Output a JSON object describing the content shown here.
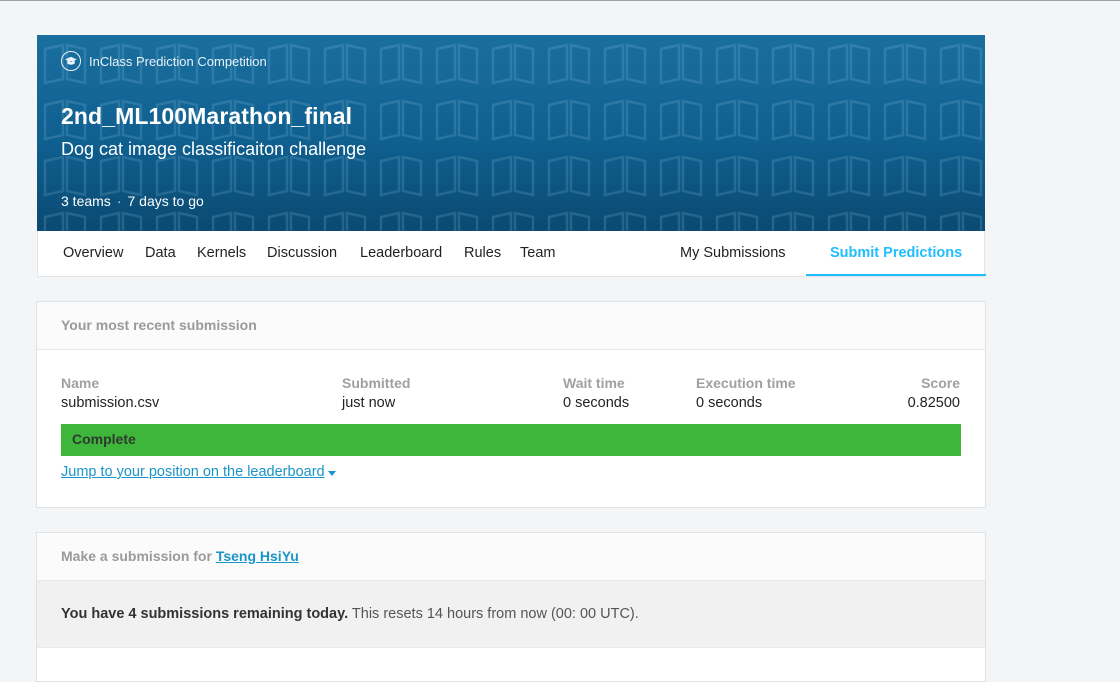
{
  "banner": {
    "badge_label": "InClass Prediction Competition",
    "title": "2nd_ML100Marathon_final",
    "subtitle": "Dog cat image classificaiton challenge",
    "teams": "3 teams",
    "separator": "·",
    "time_left": "7 days to go"
  },
  "nav": {
    "tabs": [
      "Overview",
      "Data",
      "Kernels",
      "Discussion",
      "Leaderboard",
      "Rules",
      "Team"
    ],
    "my_submissions": "My Submissions",
    "submit_predictions": "Submit Predictions",
    "accent": "#20beff"
  },
  "recent": {
    "header": "Your most recent submission",
    "columns": {
      "name": {
        "label": "Name",
        "value": "submission.csv"
      },
      "submitted": {
        "label": "Submitted",
        "value": "just now"
      },
      "wait": {
        "label": "Wait time",
        "value": "0 seconds"
      },
      "execution": {
        "label": "Execution time",
        "value": "0 seconds"
      },
      "score": {
        "label": "Score",
        "value": "0.82500"
      }
    },
    "status": "Complete",
    "status_color": "#3eb53b",
    "jump_link": "Jump to your position on the leaderboard"
  },
  "submit": {
    "header_prefix": "Make a submission for",
    "user": "Tseng HsiYu",
    "remaining_bold": "You have 4 submissions remaining today.",
    "remaining_rest": "This resets 14 hours from now (00: 00 UTC)."
  }
}
